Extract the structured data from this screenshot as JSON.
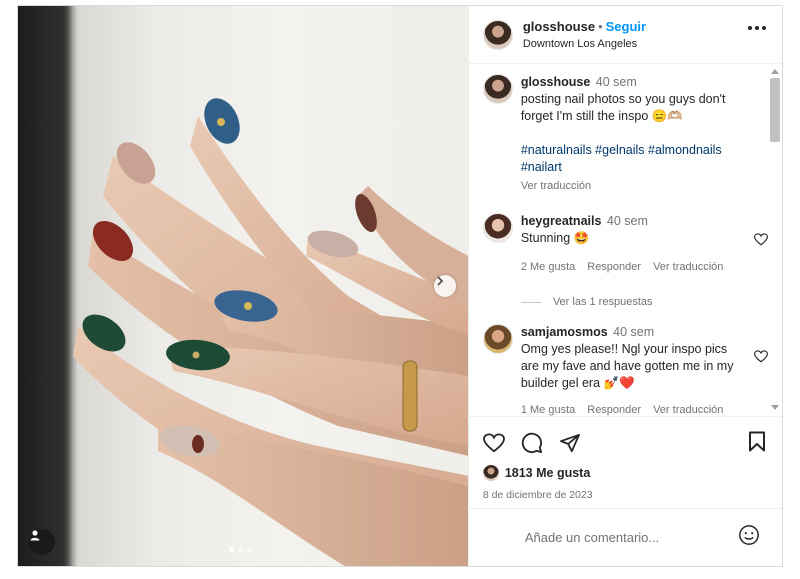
{
  "post": {
    "username": "glosshouse",
    "separator": "•",
    "follow_label": "Seguir",
    "location": "Downtown Los Angeles",
    "more_icon": "more-horizontal-icon"
  },
  "media": {
    "carousel_dots": 3,
    "active_dot": 0,
    "next_icon": "chevron-right-icon",
    "tag_icon": "user-tag-icon"
  },
  "caption": {
    "username": "glosshouse",
    "time": "40 sem",
    "text": "posting nail photos so you guys don't forget I'm still the inspo 😑🫶🏼",
    "hashtags": "#naturalnails #gelnails #almondnails #nailart",
    "translate": "Ver traducción"
  },
  "comments": [
    {
      "username": "heygreatnails",
      "time": "40 sem",
      "text": "Stunning 🤩",
      "likes": "2 Me gusta",
      "reply": "Responder",
      "translate": "Ver traducción",
      "replies": "Ver las 1 respuestas"
    },
    {
      "username": "samjamosmos",
      "time": "40 sem",
      "text": "Omg yes please!! Ngl your inspo pics are my fave and have gotten me in my builder gel era 💅❤️",
      "likes": "1 Me gusta",
      "reply": "Responder",
      "translate": "Ver traducción"
    }
  ],
  "actions": {
    "icons": [
      "heart-icon",
      "comment-icon",
      "share-icon",
      "bookmark-icon"
    ],
    "likes": "1813 Me gusta",
    "date": "8 de diciembre de 2023"
  },
  "add_comment": {
    "placeholder": "Añade un comentario...",
    "emoji_icon": "smiley-icon"
  },
  "colors": {
    "accent": "#0095f6",
    "hashtag": "#00376b",
    "muted": "#737373",
    "text": "#262626"
  }
}
